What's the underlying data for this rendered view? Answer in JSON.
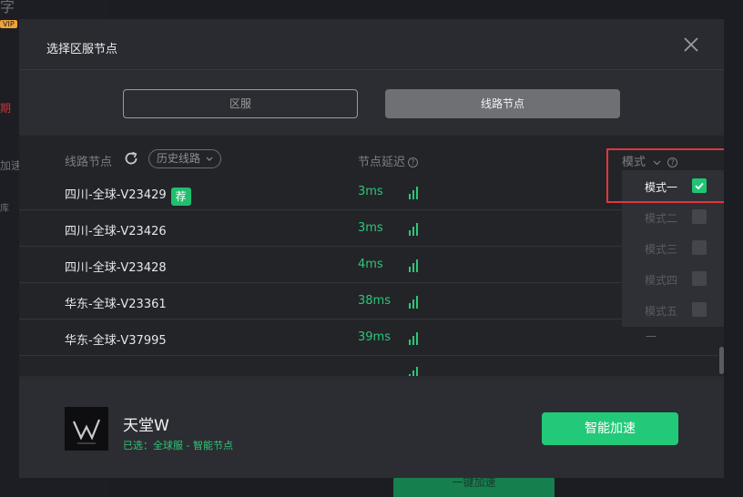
{
  "background": {
    "fragments": [
      "字",
      "期",
      "加速",
      "库"
    ],
    "bottom_button": "一键加速"
  },
  "dialog": {
    "title": "选择区服节点",
    "tabs": [
      {
        "label": "区服",
        "active": false
      },
      {
        "label": "线路节点",
        "active": true
      }
    ],
    "columns": {
      "node": "线路节点",
      "history": "历史线路",
      "latency": "节点延迟",
      "mode": "模式"
    },
    "rows": [
      {
        "name": "四川-全球-V23429",
        "badge": "荐",
        "latency": "3ms"
      },
      {
        "name": "四川-全球-V23426",
        "badge": "",
        "latency": "3ms"
      },
      {
        "name": "四川-全球-V23428",
        "badge": "",
        "latency": "4ms"
      },
      {
        "name": "华东-全球-V23361",
        "badge": "",
        "latency": "38ms"
      },
      {
        "name": "华东-全球-V37995",
        "badge": "",
        "latency": "39ms"
      }
    ],
    "row_dash": "—",
    "mode_options": [
      {
        "label": "模式一",
        "checked": true
      },
      {
        "label": "模式二",
        "checked": false
      },
      {
        "label": "模式三",
        "checked": false
      },
      {
        "label": "模式四",
        "checked": false
      },
      {
        "label": "模式五",
        "checked": false
      }
    ],
    "footer": {
      "game_name": "天堂W",
      "selection": "已选：全球服 - 智能节点",
      "action": "智能加速"
    }
  },
  "colors": {
    "accent_green": "#22c978",
    "highlight_red": "#e0373d",
    "dialog_bg": "#2a2b30"
  }
}
